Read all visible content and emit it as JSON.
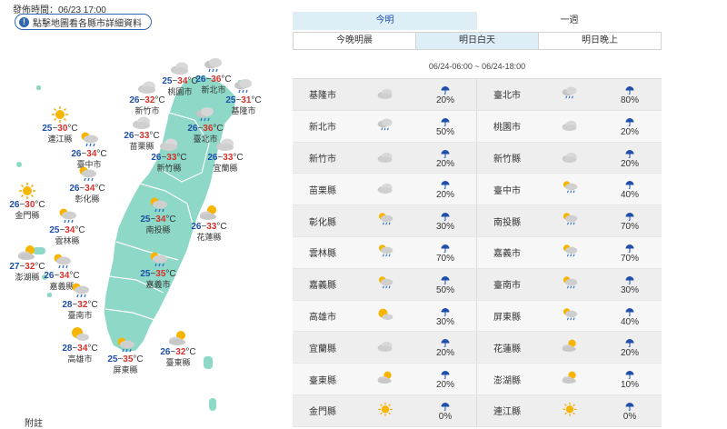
{
  "release_time": "發佈時間：06/23 17:00",
  "detail_button": "點擊地圖看各縣市詳細資料",
  "notes_label": "附註",
  "tabs_primary": [
    "今明",
    "一週"
  ],
  "tabs_secondary": [
    "今晚明晨",
    "明日白天",
    "明日晚上"
  ],
  "time_range": "06/24-06:00 ~ 06/24-18:00",
  "colors": {
    "accent_tab": "#ddeef6",
    "map_land": "#8dd8c6",
    "low_temp": "#1f4fa8",
    "high_temp": "#d5322b",
    "umbrella": "#1f4fa8"
  },
  "map_cities": [
    {
      "name": "桃園市",
      "low": "25",
      "high": "34",
      "icon": "cloudy-icon"
    },
    {
      "name": "新北市",
      "low": "26",
      "high": "36",
      "icon": "cloudy-rain-icon"
    },
    {
      "name": "新竹市",
      "low": "26",
      "high": "32",
      "icon": "cloudy-icon"
    },
    {
      "name": "基隆市",
      "low": "25",
      "high": "31",
      "icon": "cloudy-rain-icon"
    },
    {
      "name": "臺北市",
      "low": "26",
      "high": "36",
      "icon": "cloudy-rain-icon"
    },
    {
      "name": "連江縣",
      "low": "25",
      "high": "30",
      "icon": "sunny-icon"
    },
    {
      "name": "苗栗縣",
      "low": "26",
      "high": "33",
      "icon": "cloudy-icon"
    },
    {
      "name": "臺中市",
      "low": "26",
      "high": "34",
      "icon": "sun-cloud-rain-icon"
    },
    {
      "name": "新竹縣",
      "low": "26",
      "high": "33",
      "icon": "cloudy-icon"
    },
    {
      "name": "宜蘭縣",
      "low": "26",
      "high": "33",
      "icon": "cloudy-icon"
    },
    {
      "name": "彰化縣",
      "low": "26",
      "high": "34",
      "icon": "sun-cloud-rain-icon"
    },
    {
      "name": "金門縣",
      "low": "26",
      "high": "30",
      "icon": "sunny-icon"
    },
    {
      "name": "南投縣",
      "low": "25",
      "high": "34",
      "icon": "sun-cloud-rain-icon"
    },
    {
      "name": "花蓮縣",
      "low": "26",
      "high": "33",
      "icon": "partly-cloudy-icon"
    },
    {
      "name": "雲林縣",
      "low": "25",
      "high": "34",
      "icon": "sun-cloud-rain-icon"
    },
    {
      "name": "澎湖縣",
      "low": "27",
      "high": "32",
      "icon": "partly-cloudy-icon"
    },
    {
      "name": "嘉義縣",
      "low": "26",
      "high": "34",
      "icon": "sun-cloud-rain-icon"
    },
    {
      "name": "嘉義市",
      "low": "25",
      "high": "35",
      "icon": "sun-cloud-rain-icon"
    },
    {
      "name": "臺南市",
      "low": "28",
      "high": "32",
      "icon": "sun-cloud-rain-icon"
    },
    {
      "name": "高雄市",
      "low": "28",
      "high": "34",
      "icon": "sun-cloud-icon"
    },
    {
      "name": "臺東縣",
      "low": "26",
      "high": "32",
      "icon": "partly-cloudy-icon"
    },
    {
      "name": "屏東縣",
      "low": "25",
      "high": "35",
      "icon": "sun-cloud-rain-icon"
    }
  ],
  "table_rows": [
    [
      {
        "name": "基隆市",
        "icon": "cloudy-icon",
        "rain": "20%"
      },
      {
        "name": "臺北市",
        "icon": "cloudy-rain-icon",
        "rain": "80%"
      }
    ],
    [
      {
        "name": "新北市",
        "icon": "cloudy-rain-icon",
        "rain": "50%"
      },
      {
        "name": "桃園市",
        "icon": "cloudy-icon",
        "rain": "20%"
      }
    ],
    [
      {
        "name": "新竹市",
        "icon": "cloudy-icon",
        "rain": "20%"
      },
      {
        "name": "新竹縣",
        "icon": "cloudy-icon",
        "rain": "20%"
      }
    ],
    [
      {
        "name": "苗栗縣",
        "icon": "cloudy-icon",
        "rain": "20%"
      },
      {
        "name": "臺中市",
        "icon": "sun-cloud-rain-icon",
        "rain": "40%"
      }
    ],
    [
      {
        "name": "彰化縣",
        "icon": "sun-cloud-rain-icon",
        "rain": "30%"
      },
      {
        "name": "南投縣",
        "icon": "sun-cloud-rain-icon",
        "rain": "70%"
      }
    ],
    [
      {
        "name": "雲林縣",
        "icon": "sun-cloud-rain-icon",
        "rain": "70%"
      },
      {
        "name": "嘉義市",
        "icon": "sun-cloud-rain-icon",
        "rain": "70%"
      }
    ],
    [
      {
        "name": "嘉義縣",
        "icon": "sun-cloud-rain-icon",
        "rain": "50%"
      },
      {
        "name": "臺南市",
        "icon": "sun-cloud-rain-icon",
        "rain": "30%"
      }
    ],
    [
      {
        "name": "高雄市",
        "icon": "sun-cloud-icon",
        "rain": "30%"
      },
      {
        "name": "屏東縣",
        "icon": "sun-cloud-rain-icon",
        "rain": "40%"
      }
    ],
    [
      {
        "name": "宜蘭縣",
        "icon": "cloudy-icon",
        "rain": "20%"
      },
      {
        "name": "花蓮縣",
        "icon": "partly-cloudy-icon",
        "rain": "20%"
      }
    ],
    [
      {
        "name": "臺東縣",
        "icon": "partly-cloudy-icon",
        "rain": "20%"
      },
      {
        "name": "澎湖縣",
        "icon": "partly-cloudy-icon",
        "rain": "10%"
      }
    ],
    [
      {
        "name": "金門縣",
        "icon": "sunny-icon",
        "rain": "0%"
      },
      {
        "name": "連江縣",
        "icon": "sunny-icon",
        "rain": "0%"
      }
    ]
  ]
}
